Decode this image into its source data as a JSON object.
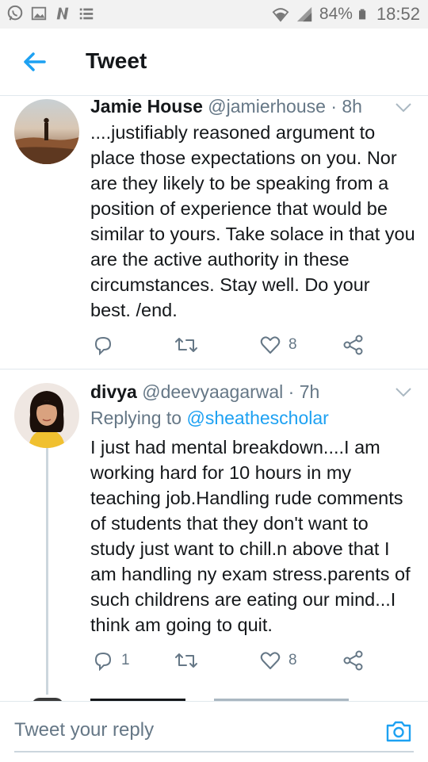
{
  "status_bar": {
    "battery": "84%",
    "time": "18:52",
    "left_icons": [
      "whatsapp-icon",
      "image-icon",
      "n-app-icon",
      "list-icon"
    ],
    "right_icons": [
      "wifi-icon",
      "signal-icon",
      "battery-icon"
    ]
  },
  "header": {
    "title": "Tweet"
  },
  "tweets": [
    {
      "name": "Jamie House",
      "handle": "@jamierhouse · 8h",
      "text": "....justifiably reasoned argument to place those expectations on you. Nor are they likely to be speaking from a position of experience that would be similar to yours. Take solace in that you are the active authority in these circumstances. Stay well. Do your best. /end.",
      "reply_count": "",
      "like_count": "8"
    },
    {
      "name": "divya",
      "handle": "@deevyaagarwal · 7h",
      "replying_prefix": "Replying to",
      "replying_to": "@sheathescholar",
      "text": "I just had mental breakdown....I am working hard for 10 hours in my teaching job.Handling rude comments of students that they don't want to study just want to chill.n above that I am handling ny exam stress.parents of such childrens are eating our mind...I think am going to quit.",
      "reply_count": "1",
      "like_count": "8"
    }
  ],
  "composer": {
    "placeholder": "Tweet your reply"
  },
  "colors": {
    "accent": "#1da1f2",
    "muted": "#657786",
    "text": "#14171a",
    "divider": "#e1e8ed"
  }
}
